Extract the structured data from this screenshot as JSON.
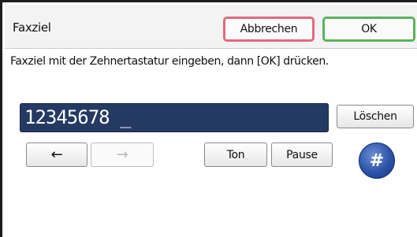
{
  "header": {
    "title": "Faxziel",
    "cancel_label": "Abbrechen",
    "ok_label": "OK"
  },
  "instruction": "Faxziel mit der Zehnertastatur eingeben, dann [OK] drücken.",
  "number_field": {
    "value": "12345678 _"
  },
  "buttons": {
    "clear_label": "Löschen",
    "left_arrow": "←",
    "right_arrow": "→",
    "ton_label": "Ton",
    "pause_label": "Pause",
    "hash_label": "#"
  },
  "colors": {
    "cancel_border": "#e26a7c",
    "ok_border": "#59b45c",
    "field_background": "#243a63",
    "hash_button": "#2c53a8"
  }
}
